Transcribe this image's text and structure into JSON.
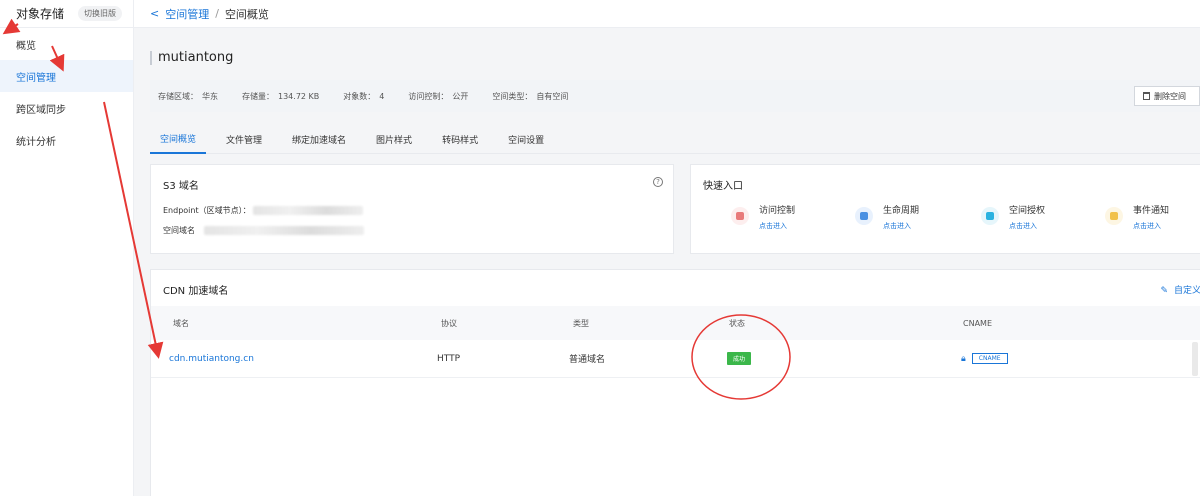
{
  "sidebar": {
    "title": "对象存储",
    "switch_label": "切换旧版",
    "items": [
      {
        "label": "概览"
      },
      {
        "label": "空间管理"
      },
      {
        "label": "跨区域同步"
      },
      {
        "label": "统计分析"
      }
    ]
  },
  "breadcrumb": {
    "back": "<",
    "parent": "空间管理",
    "separator": "/",
    "current": "空间概览"
  },
  "bucket": {
    "name": "mutiantong"
  },
  "info": {
    "region_label": "存储区域：",
    "region_value": "华东",
    "storage_label": "存储量：",
    "storage_value": "134.72 KB",
    "objects_label": "对象数：",
    "objects_value": "4",
    "access_label": "访问控制：",
    "access_value": "公开",
    "type_label": "空间类型：",
    "type_value": "自有空间",
    "delete_label": "删除空间"
  },
  "tabs": [
    {
      "label": "空间概览"
    },
    {
      "label": "文件管理"
    },
    {
      "label": "绑定加速域名"
    },
    {
      "label": "图片样式"
    },
    {
      "label": "转码样式"
    },
    {
      "label": "空间设置"
    }
  ],
  "s3": {
    "title": "S3 域名",
    "help": "?",
    "endpoint_label": "Endpoint（区域节点）：",
    "domain_label": "空间域名"
  },
  "quick": {
    "title": "快速入口",
    "items": [
      {
        "label": "访问控制",
        "link": "点击进入"
      },
      {
        "label": "生命周期",
        "link": "点击进入"
      },
      {
        "label": "空间授权",
        "link": "点击进入"
      },
      {
        "label": "事件通知",
        "link": "点击进入"
      }
    ]
  },
  "cdn": {
    "title": "CDN 加速域名",
    "edit_label": "自定义域名",
    "columns": [
      "域名",
      "协议",
      "类型",
      "状态",
      "CNAME"
    ],
    "rows": [
      {
        "domain": "cdn.mutiantong.cn",
        "protocol": "HTTP",
        "type": "普通域名",
        "status": "成功",
        "cname": "CNAME"
      }
    ]
  },
  "colors": {
    "accent": "#1a76d8",
    "success": "#3bb74a",
    "annotation": "#e53935"
  }
}
